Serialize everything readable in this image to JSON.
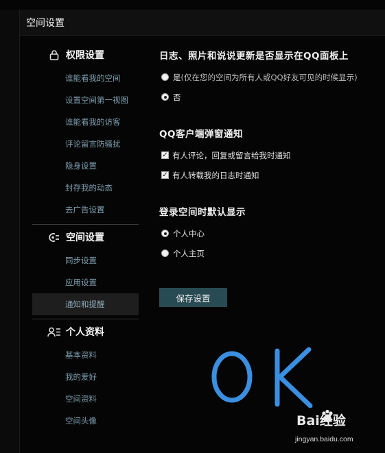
{
  "panel": {
    "title": "空间设置"
  },
  "sidebar": {
    "groups": [
      {
        "title": "权限设置",
        "icon": "lock-icon",
        "items": [
          "谁能看我的空间",
          "设置空间第一视图",
          "谁能看我的访客",
          "评论留言防骚扰",
          "隐身设置",
          "封存我的动态",
          "去广告设置"
        ]
      },
      {
        "title": "空间设置",
        "icon": "space-settings-icon",
        "items": [
          "同步设置",
          "应用设置",
          "通知和提醒"
        ],
        "active_item": "通知和提醒"
      },
      {
        "title": "个人资料",
        "icon": "profile-icon",
        "items": [
          "基本资料",
          "我的爱好",
          "空间资料",
          "空间头像"
        ]
      }
    ]
  },
  "main": {
    "sections": [
      {
        "title": "日志、照片和说说更新是否显示在QQ面板上",
        "options": [
          {
            "label": "是",
            "hint": "(仅在您的空间为所有人或QQ好友可见的时候显示)",
            "type": "radio",
            "checked": false
          },
          {
            "label": "否",
            "hint": "",
            "type": "radio",
            "checked": true
          }
        ]
      },
      {
        "title": "QQ客户端弹窗通知",
        "options": [
          {
            "label": "有人评论，回复或留言给我时通知",
            "type": "checkbox",
            "checked": true
          },
          {
            "label": "有人转载我的日志时通知",
            "type": "checkbox",
            "checked": true
          }
        ]
      },
      {
        "title": "登录空间时默认显示",
        "options": [
          {
            "label": "个人中心",
            "type": "radio",
            "checked": true
          },
          {
            "label": "个人主页",
            "type": "radio",
            "checked": false
          }
        ]
      }
    ],
    "save_label": "保存设置"
  },
  "annotation": {
    "text": "OK",
    "color": "#3a8fe0"
  },
  "watermark": {
    "brand": "Bai经验",
    "url": "jingyan.baidu.com"
  },
  "colors": {
    "accent_button": "#284a52",
    "nav_link": "#7e9fb0"
  }
}
